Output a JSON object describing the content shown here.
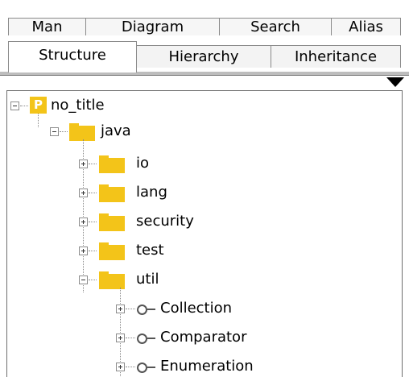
{
  "tabs_top": [
    "Man",
    "Diagram",
    "Search",
    "Alias"
  ],
  "tabs_bottom": [
    "Structure",
    "Hierarchy",
    "Inheritance"
  ],
  "active_tab": "Structure",
  "tree": {
    "root": {
      "icon_letter": "P",
      "label": "no_title"
    },
    "java": {
      "label": "java"
    },
    "packages": [
      "io",
      "lang",
      "security",
      "test",
      "util"
    ],
    "interfaces": [
      "Collection",
      "Comparator",
      "Enumeration"
    ]
  },
  "colors": {
    "folder": "#f3c419",
    "frame": "#bdbdbd"
  },
  "icons": {
    "dropdown": "dropdown-arrow-icon",
    "folder": "folder-icon",
    "package": "package-icon",
    "interface": "interface-icon"
  }
}
